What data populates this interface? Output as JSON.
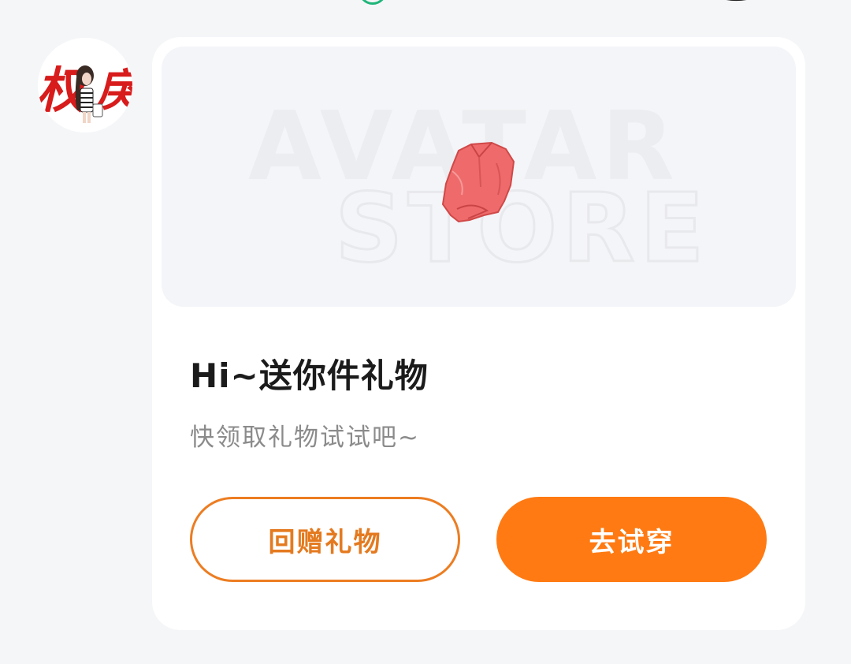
{
  "message_card": {
    "banner_watermark_line1": "AVATAR",
    "banner_watermark_line2": "STORE",
    "title": "Hi~送你件礼物",
    "subtitle": "快领取礼物试试吧~",
    "return_gift_button": "回赠礼物",
    "try_on_button": "去试穿"
  },
  "sender_avatar": {
    "text_left": "权",
    "text_right": "戾"
  },
  "colors": {
    "background": "#f5f6f8",
    "card": "#ffffff",
    "banner": "#f4f5f8",
    "accent_orange": "#ff7a12",
    "outline_orange": "#ec7d22",
    "title_text": "#1b1b1b",
    "subtitle_text": "#8b8b8b",
    "gift_item": "#ef6b6b",
    "status_green": "#1fb57a"
  },
  "icons": {
    "gift_item": "red-shirt-icon",
    "top_status": "green-circle-icon"
  }
}
